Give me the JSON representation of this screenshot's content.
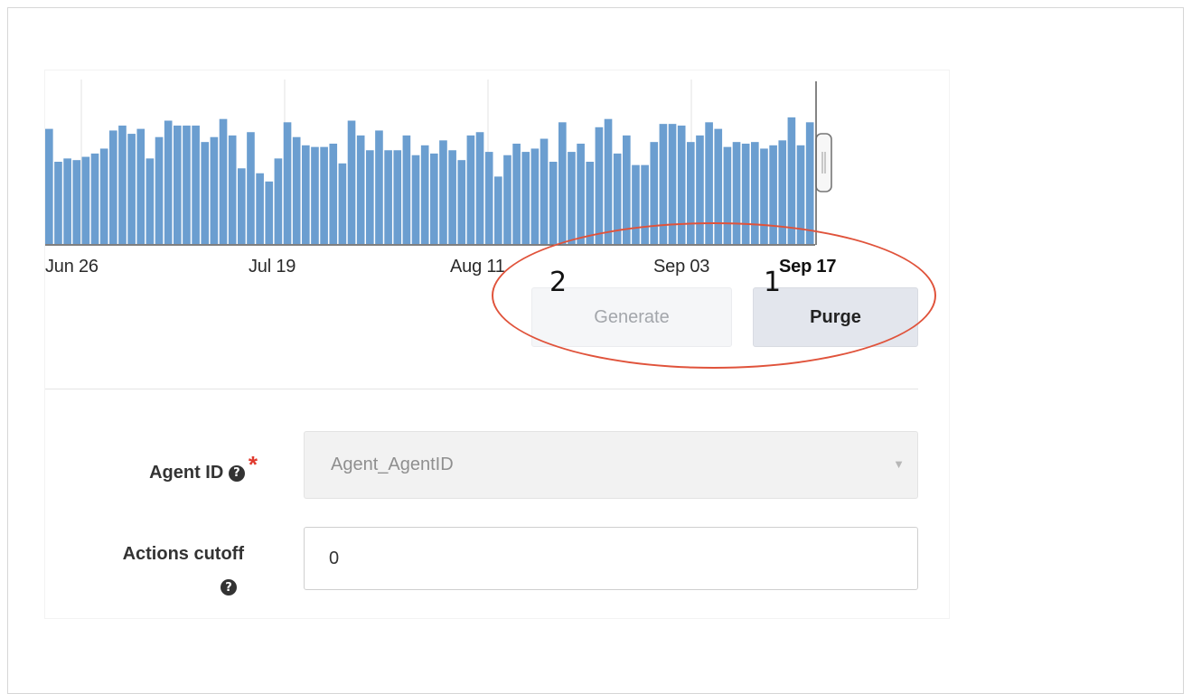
{
  "chart_data": {
    "type": "bar",
    "x_ticks": [
      "Jun 26",
      "Jul 19",
      "Aug 11",
      "Sep 03",
      "Sep 17"
    ],
    "selected_tick": "Sep 17",
    "bar_color": "#6b9ed0",
    "grid": true,
    "values": [
      70,
      50,
      52,
      51,
      53,
      55,
      58,
      69,
      72,
      67,
      70,
      52,
      65,
      75,
      72,
      72,
      72,
      62,
      65,
      76,
      66,
      46,
      68,
      43,
      38,
      52,
      74,
      65,
      60,
      59,
      59,
      61,
      49,
      75,
      66,
      57,
      69,
      57,
      57,
      66,
      54,
      60,
      55,
      63,
      57,
      51,
      66,
      68,
      56,
      41,
      54,
      61,
      56,
      58,
      64,
      50,
      74,
      56,
      61,
      50,
      71,
      76,
      55,
      66,
      48,
      48,
      62,
      73,
      73,
      72,
      62,
      66,
      74,
      70,
      59,
      62,
      61,
      62,
      58,
      60,
      63,
      77,
      60,
      74
    ],
    "ylim": [
      0,
      100
    ]
  },
  "actions": {
    "generate_label": "Generate",
    "purge_label": "Purge"
  },
  "annotations": {
    "generate_marker": "2",
    "purge_marker": "1",
    "highlight_color": "#e0533b"
  },
  "form": {
    "agent_id": {
      "label": "Agent ID",
      "required_mark": "*",
      "help_glyph": "?",
      "value": "Agent_AgentID",
      "caret": "▼"
    },
    "actions_cutoff": {
      "label": "Actions cutoff",
      "help_glyph": "?",
      "value": "0"
    }
  }
}
